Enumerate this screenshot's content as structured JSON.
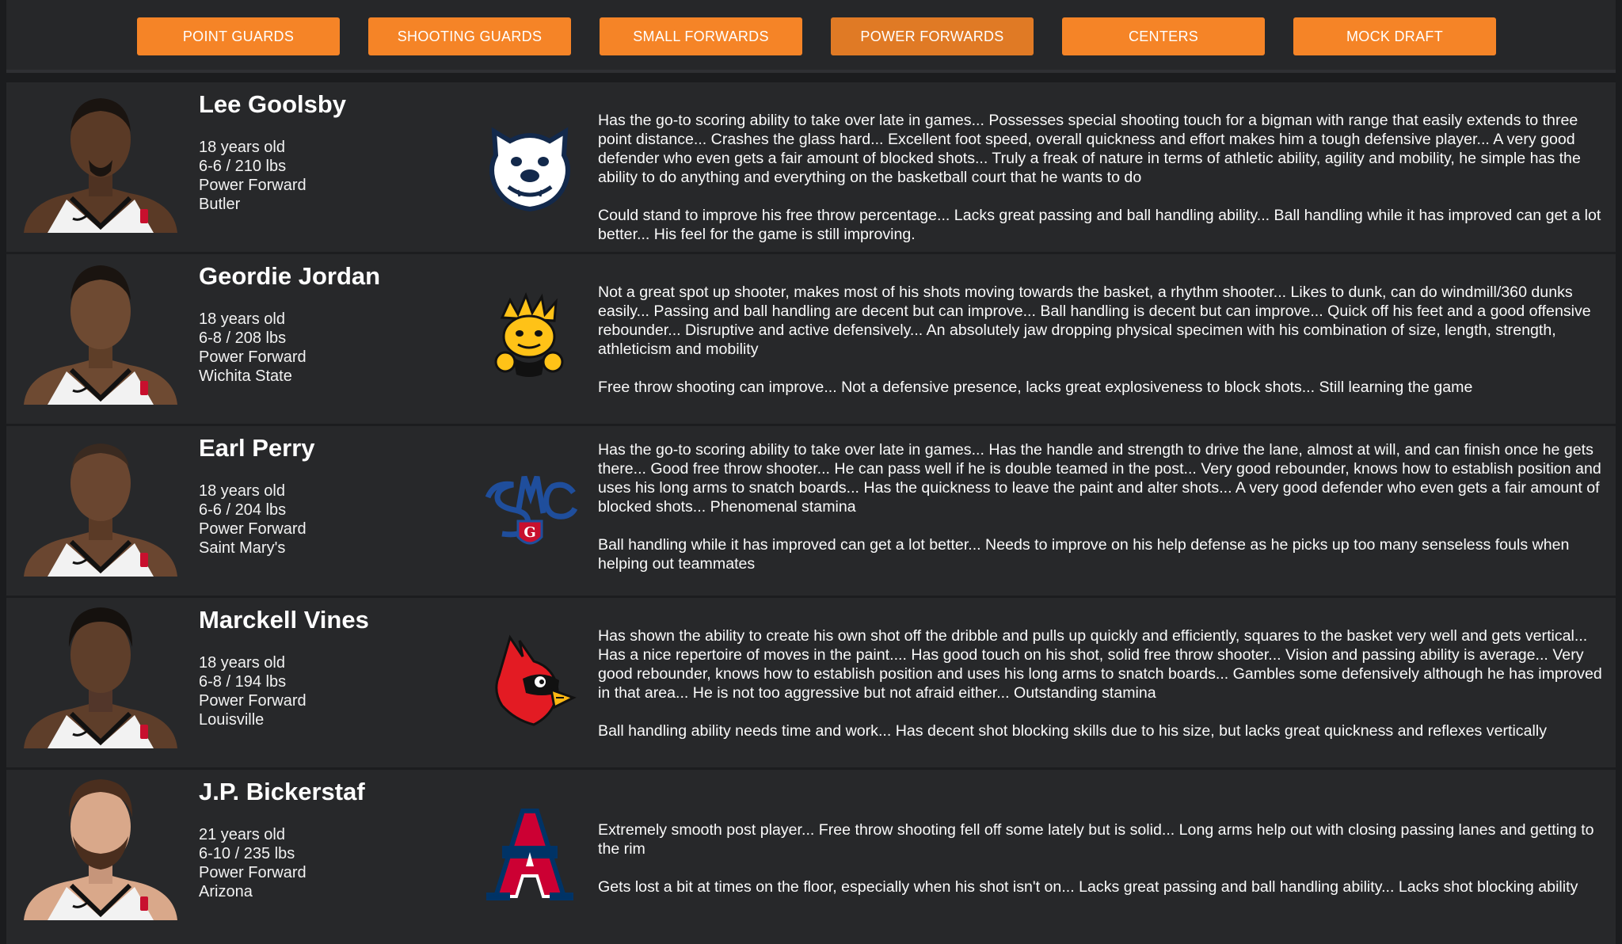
{
  "nav": [
    {
      "label": "POINT GUARDS",
      "active": false
    },
    {
      "label": "SHOOTING GUARDS",
      "active": false
    },
    {
      "label": "SMALL FORWARDS",
      "active": false
    },
    {
      "label": "POWER FORWARDS",
      "active": true
    },
    {
      "label": "CENTERS",
      "active": false
    },
    {
      "label": "MOCK DRAFT",
      "active": false
    }
  ],
  "players": [
    {
      "name": "Lee Goolsby",
      "age": "18 years old",
      "size": "6-6 / 210 lbs",
      "position": "Power Forward",
      "school": "Butler",
      "logo_icon": "butler-bulldog-icon",
      "strengths": "Has the go-to scoring ability to take over late in games... Possesses special shooting touch for a bigman with range that easily extends to three point distance... Crashes the glass hard... Excellent foot speed, overall quickness and effort makes him a tough defensive player... A very good defender who even gets a fair amount of blocked shots... Truly a freak of nature in terms of athletic ability, agility and mobility, he simple has the ability to do anything and everything on the basketball court that he wants to do",
      "weaknesses": "Could stand to improve his free throw percentage... Lacks great passing and ball handling ability... Ball handling while it has improved can get a lot better... His feel for the game is still improving.",
      "skin": "#5a3a26",
      "hair": "#1a1410"
    },
    {
      "name": "Geordie Jordan",
      "age": "18 years old",
      "size": "6-8 / 208 lbs",
      "position": "Power Forward",
      "school": "Wichita State",
      "logo_icon": "wichita-shocker-icon",
      "strengths": "Not a great spot up shooter, makes most of his shots moving towards the basket, a rhythm shooter... Likes to dunk, can do windmill/360 dunks easily... Passing and ball handling are decent but can improve... Ball handling is decent but can improve... Quick off his feet and a good offensive rebounder... Disruptive and active defensively... An absolutely jaw dropping physical specimen with his combination of size, length, strength, athleticism and mobility",
      "weaknesses": "Free throw shooting can improve... Not a defensive presence, lacks great explosiveness to block shots... Still learning the game",
      "skin": "#6e4a32",
      "hair": "#1a1410"
    },
    {
      "name": "Earl Perry",
      "age": "18 years old",
      "size": "6-6 / 204 lbs",
      "position": "Power Forward",
      "school": "Saint Mary's",
      "logo_icon": "saint-marys-smc-icon",
      "strengths": "Has the go-to scoring ability to take over late in games... Has the handle and strength to drive the lane, almost at will, and can finish once he gets there... Good free throw shooter... He can pass well if he is double teamed in the post... Very good rebounder, knows how to establish position and uses his long arms to snatch boards... Has the quickness to leave the paint and alter shots... A very good defender who even gets a fair amount of blocked shots... Phenomenal stamina",
      "weaknesses": "Ball handling while it has improved can get a lot better... Needs to improve on his help defense as he picks up too many senseless fouls when helping out teammates",
      "skin": "#6a4630",
      "hair": "#3a2a20"
    },
    {
      "name": "Marckell Vines",
      "age": "18 years old",
      "size": "6-8 / 194 lbs",
      "position": "Power Forward",
      "school": "Louisville",
      "logo_icon": "louisville-cardinal-icon",
      "strengths": "Has shown the ability to create his own shot off the dribble and pulls up quickly and efficiently, squares to the basket very well and gets vertical... Has a nice repertoire of moves in the paint.... Has good touch on his shot, solid free throw shooter... Vision and passing ability is average... Very good rebounder, knows how to establish position and uses his long arms to snatch boards... Gambles some defensively although he has improved in that area... He is not too aggressive but not afraid either... Outstanding stamina",
      "weaknesses": "Ball handling ability needs time and work... Has decent shot blocking skills due to his size, but lacks great quickness and reflexes vertically",
      "skin": "#5e3e2a",
      "hair": "#15110e"
    },
    {
      "name": "J.P. Bickerstaf",
      "age": "21 years old",
      "size": "6-10 / 235 lbs",
      "position": "Power Forward",
      "school": "Arizona",
      "logo_icon": "arizona-a-icon",
      "strengths": "Extremely smooth post player... Free throw shooting fell off some lately but is solid... Long arms help out with closing passing lanes and getting to the rim",
      "weaknesses": "Gets lost a bit at times on the floor, especially when his shot isn't on... Lacks great passing and ball handling ability... Lacks shot blocking ability",
      "skin": "#d9a88a",
      "hair": "#4a2e1e"
    }
  ],
  "colors": {
    "accent": "#f58427",
    "background": "#1b1c1e",
    "row": "#27282a"
  }
}
